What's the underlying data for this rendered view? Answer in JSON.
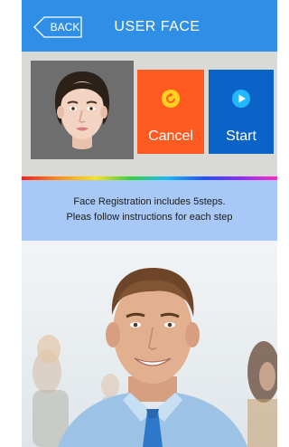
{
  "header": {
    "back_label": "BACK",
    "title": "USER FACE",
    "background": "#2f8fe6"
  },
  "actions": {
    "cancel": {
      "label": "Cancel",
      "icon": "undo-icon",
      "color": "#ff5a1f"
    },
    "start": {
      "label": "Start",
      "icon": "play-icon",
      "color": "#0a63c7"
    }
  },
  "info": {
    "line1": "Face Registration includes 5steps.",
    "line2": "Pleas follow instructions for each step",
    "background": "#a8c9f7"
  }
}
